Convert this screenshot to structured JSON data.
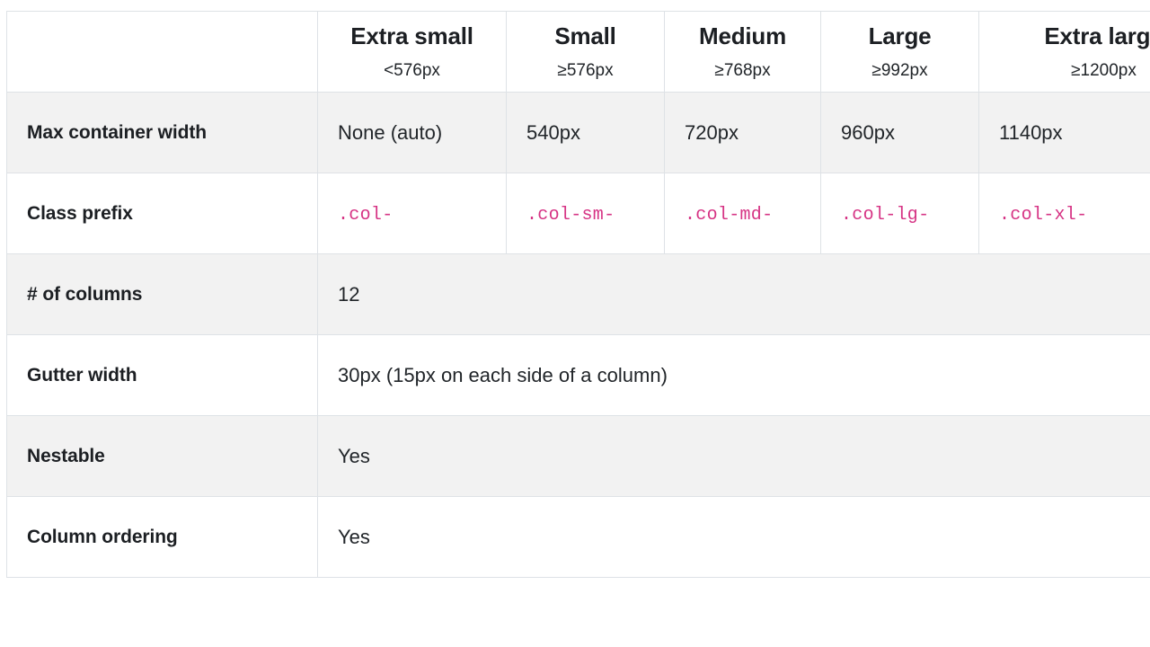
{
  "table": {
    "corner_label": "",
    "breakpoints": [
      {
        "name": "Extra small",
        "range": "<576px"
      },
      {
        "name": "Small",
        "range": "≥576px"
      },
      {
        "name": "Medium",
        "range": "≥768px"
      },
      {
        "name": "Large",
        "range": "≥992px"
      },
      {
        "name": "Extra large",
        "range": "≥1200px"
      }
    ],
    "rows": [
      {
        "label": "Max container width",
        "span": false,
        "values": [
          "None (auto)",
          "540px",
          "720px",
          "960px",
          "1140px"
        ],
        "code": false,
        "striped": true
      },
      {
        "label": "Class prefix",
        "span": false,
        "values": [
          ".col-",
          ".col-sm-",
          ".col-md-",
          ".col-lg-",
          ".col-xl-"
        ],
        "code": true,
        "striped": false
      },
      {
        "label": "# of columns",
        "span": true,
        "values": [
          "12"
        ],
        "code": false,
        "striped": true
      },
      {
        "label": "Gutter width",
        "span": true,
        "values": [
          "30px (15px on each side of a column)"
        ],
        "code": false,
        "striped": false
      },
      {
        "label": "Nestable",
        "span": true,
        "values": [
          "Yes"
        ],
        "code": false,
        "striped": true
      },
      {
        "label": "Column ordering",
        "span": true,
        "values": [
          "Yes"
        ],
        "code": false,
        "striped": false
      }
    ]
  },
  "colors": {
    "code_pink": "#d63384",
    "border": "#dee2e6",
    "stripe": "#f2f2f2",
    "text": "#212529"
  }
}
